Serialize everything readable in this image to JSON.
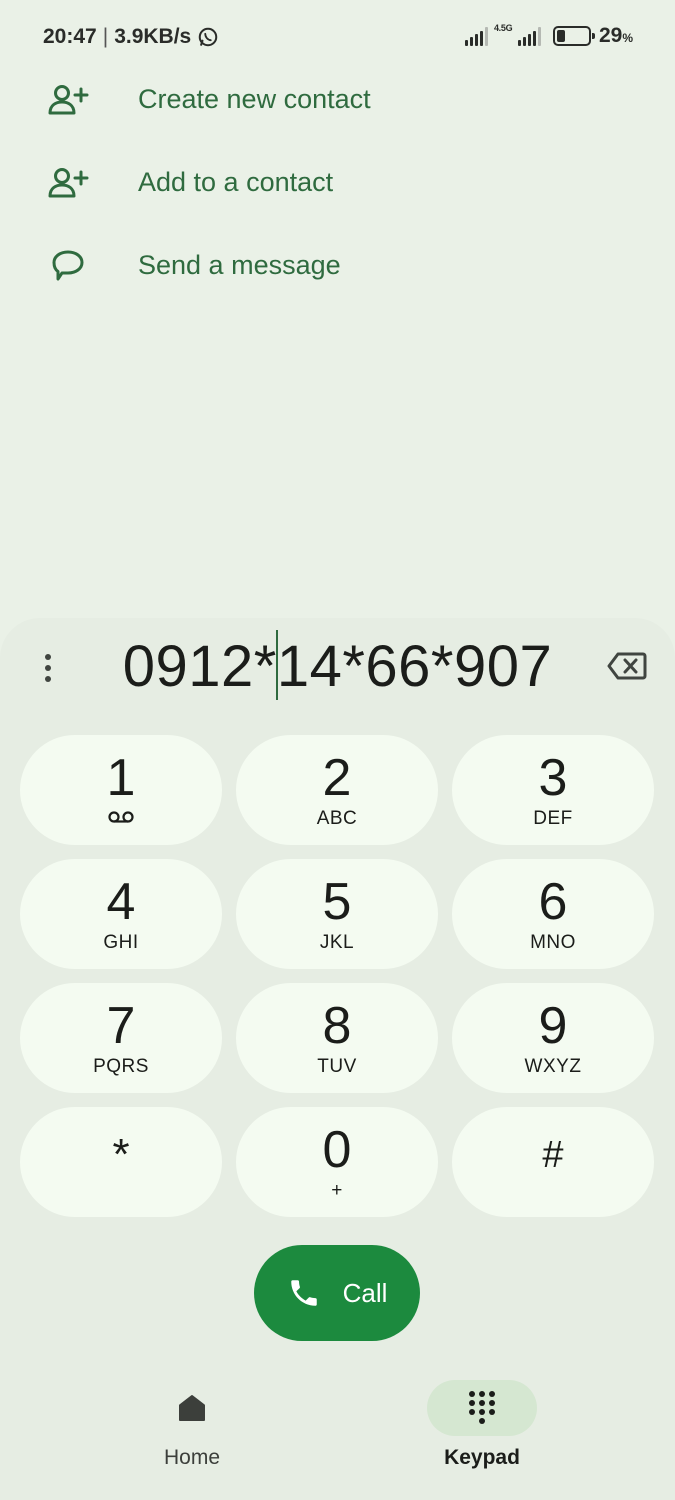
{
  "status_bar": {
    "time": "20:47",
    "separator": "|",
    "net_speed": "3.9KB/s",
    "network_type": "4.5G",
    "battery_value": "29",
    "battery_unit": "%"
  },
  "actions": [
    {
      "label": "Create new contact",
      "icon": "person-add-icon"
    },
    {
      "label": "Add to a contact",
      "icon": "person-add-icon"
    },
    {
      "label": "Send a message",
      "icon": "message-icon"
    }
  ],
  "dialer": {
    "number_before_cursor": "0912*",
    "number_after_cursor": "14*66*907"
  },
  "keypad": {
    "keys": [
      {
        "digit": "1",
        "letters": ""
      },
      {
        "digit": "2",
        "letters": "ABC"
      },
      {
        "digit": "3",
        "letters": "DEF"
      },
      {
        "digit": "4",
        "letters": "GHI"
      },
      {
        "digit": "5",
        "letters": "JKL"
      },
      {
        "digit": "6",
        "letters": "MNO"
      },
      {
        "digit": "7",
        "letters": "PQRS"
      },
      {
        "digit": "8",
        "letters": "TUV"
      },
      {
        "digit": "9",
        "letters": "WXYZ"
      },
      {
        "digit": "*",
        "letters": ""
      },
      {
        "digit": "0",
        "letters": "+"
      },
      {
        "digit": "#",
        "letters": ""
      }
    ]
  },
  "call": {
    "label": "Call"
  },
  "nav": {
    "home": {
      "label": "Home"
    },
    "keypad": {
      "label": "Keypad"
    }
  },
  "colors": {
    "accent": "#2f6b3f",
    "call_button": "#1c8a3e",
    "key_background": "#f4fbf1",
    "background": "#eaf1e7"
  }
}
